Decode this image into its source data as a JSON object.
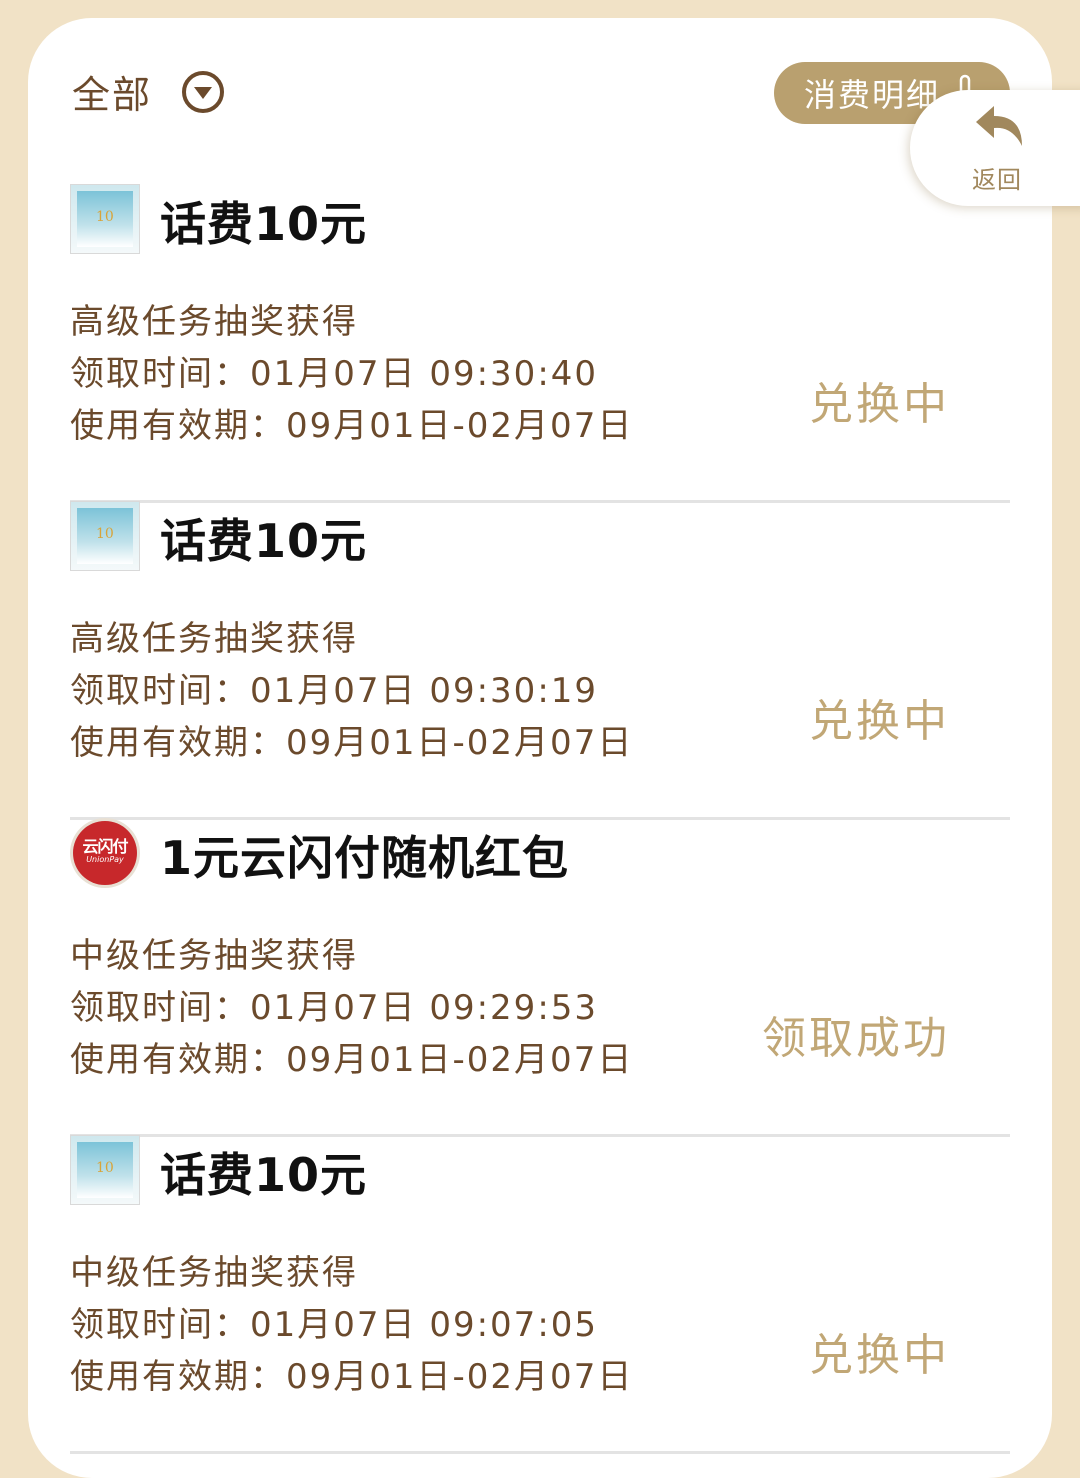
{
  "header": {
    "filter_label": "全部",
    "filter_icon": "chevron-down-circle-icon",
    "detail_button_label": "消费明细",
    "back_label": "返回"
  },
  "items": [
    {
      "title": "话费10元",
      "thumb": "phone-bill-voucher",
      "source": "高级任务抽奖获得",
      "claim_time": "领取时间：01月07日 09:30:40",
      "validity": "使用有效期：09月01日-02月07日",
      "status": "兑换中"
    },
    {
      "title": "话费10元",
      "thumb": "phone-bill-voucher",
      "source": "高级任务抽奖获得",
      "claim_time": "领取时间：01月07日 09:30:19",
      "validity": "使用有效期：09月01日-02月07日",
      "status": "兑换中"
    },
    {
      "title": "1元云闪付随机红包",
      "thumb": "unionpay-logo",
      "thumb_text": "云闪付",
      "thumb_subtext": "UnionPay",
      "source": "中级任务抽奖获得",
      "claim_time": "领取时间：01月07日 09:29:53",
      "validity": "使用有效期：09月01日-02月07日",
      "status": "领取成功"
    },
    {
      "title": "话费10元",
      "thumb": "phone-bill-voucher",
      "source": "中级任务抽奖获得",
      "claim_time": "领取时间：01月07日 09:07:05",
      "validity": "使用有效期：09月01日-02月07日",
      "status": "兑换中"
    }
  ],
  "colors": {
    "background": "#f1e2c6",
    "brown_text": "#6b4a2c",
    "gold": "#b9a06f",
    "status_gold": "#c1a776"
  }
}
